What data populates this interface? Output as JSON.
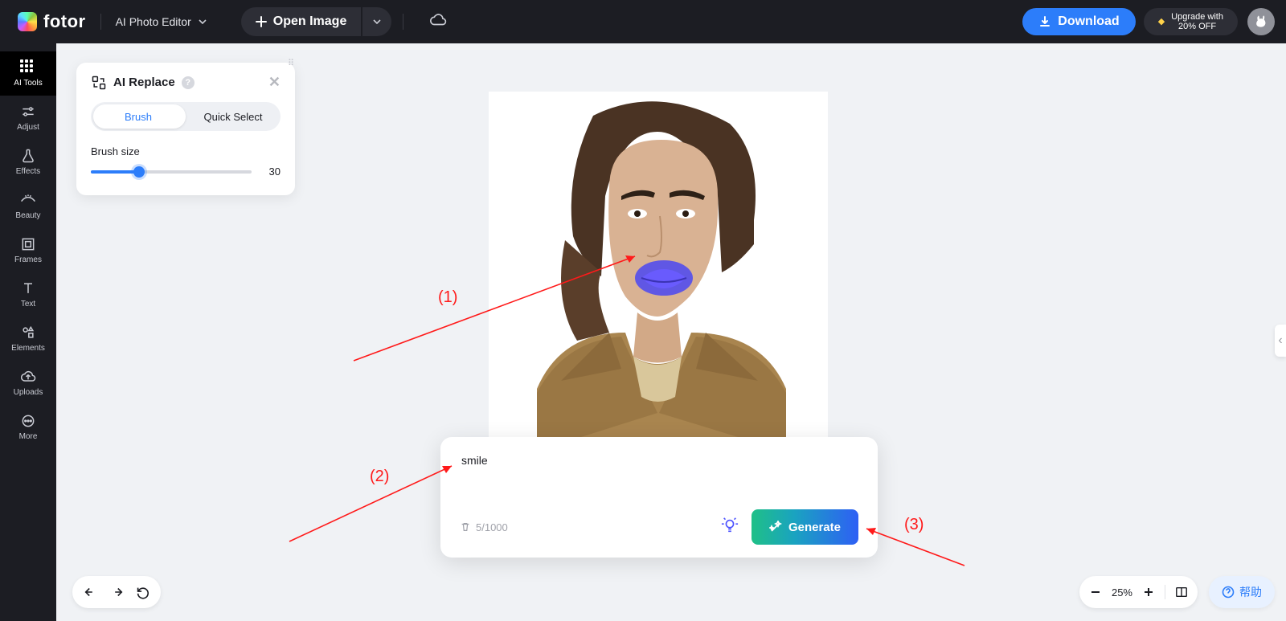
{
  "header": {
    "brand": "fotor",
    "mode": "AI Photo Editor",
    "open_label": "Open Image",
    "download_label": "Download",
    "upgrade_line1": "Upgrade with",
    "upgrade_line2": "20% OFF"
  },
  "sidebar": {
    "items": [
      {
        "id": "ai-tools",
        "label": "AI Tools"
      },
      {
        "id": "adjust",
        "label": "Adjust"
      },
      {
        "id": "effects",
        "label": "Effects"
      },
      {
        "id": "beauty",
        "label": "Beauty"
      },
      {
        "id": "frames",
        "label": "Frames"
      },
      {
        "id": "text",
        "label": "Text"
      },
      {
        "id": "elements",
        "label": "Elements"
      },
      {
        "id": "uploads",
        "label": "Uploads"
      },
      {
        "id": "more",
        "label": "More"
      }
    ],
    "active": "ai-tools"
  },
  "panel": {
    "title": "AI Replace",
    "seg_brush": "Brush",
    "seg_quick": "Quick Select",
    "brush_label": "Brush size",
    "brush_value": "30"
  },
  "prompt": {
    "value": "smile",
    "counter": "5/1000",
    "generate_label": "Generate"
  },
  "zoom": {
    "value": "25%"
  },
  "help": {
    "label": "帮助"
  },
  "annotations": {
    "a1": "(1)",
    "a2": "(2)",
    "a3": "(3)"
  }
}
